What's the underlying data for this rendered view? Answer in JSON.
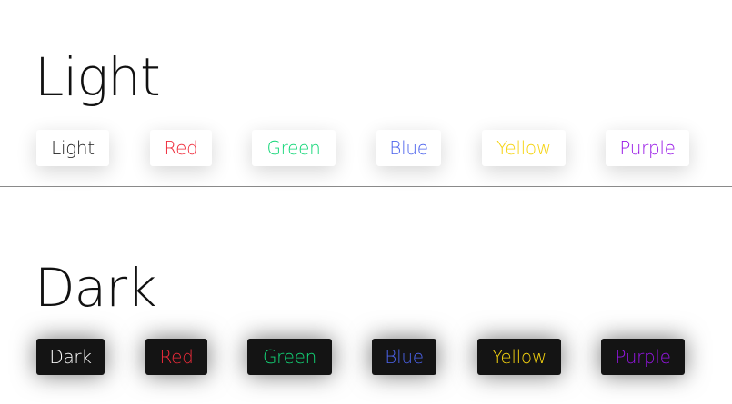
{
  "light": {
    "heading": "Light",
    "buttons": [
      {
        "label": "Light",
        "color": "#222222"
      },
      {
        "label": "Red",
        "color": "#ef2b3a"
      },
      {
        "label": "Green",
        "color": "#12d677"
      },
      {
        "label": "Blue",
        "color": "#4c63ec"
      },
      {
        "label": "Yellow",
        "color": "#f5d30f"
      },
      {
        "label": "Purple",
        "color": "#9715e6"
      }
    ]
  },
  "dark": {
    "heading": "Dark",
    "buttons": [
      {
        "label": "Dark",
        "color": "#ffffff"
      },
      {
        "label": "Red",
        "color": "#ef2b3a"
      },
      {
        "label": "Green",
        "color": "#12d677"
      },
      {
        "label": "Blue",
        "color": "#4c63ec"
      },
      {
        "label": "Yellow",
        "color": "#f5d30f"
      },
      {
        "label": "Purple",
        "color": "#9715e6"
      }
    ]
  }
}
